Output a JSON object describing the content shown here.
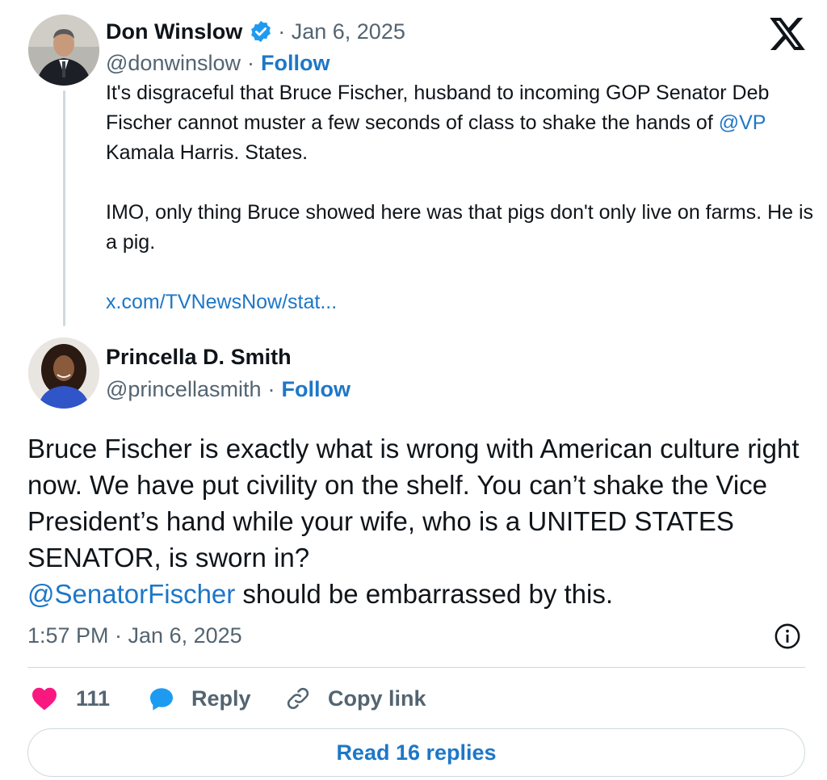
{
  "parent_tweet": {
    "author_name": "Don Winslow",
    "separator_date": "· Jan 6, 2025",
    "handle": "@donwinslow",
    "dot": "·",
    "follow_label": "Follow",
    "para1_prefix": "It's disgraceful that Bruce Fischer, husband to incoming GOP Senator Deb Fischer cannot muster a few seconds of class to shake the hands of ",
    "para1_mention": "@VP",
    "para1_suffix": " Kamala Harris. States.",
    "para2": "IMO, only thing Bruce showed here was that pigs don't only live on farms. He is a pig.",
    "link": "x.com/TVNewsNow/stat..."
  },
  "main_tweet": {
    "author_name": "Princella D. Smith",
    "handle": "@princellasmith",
    "dot": "·",
    "follow_label": "Follow",
    "text_main": "Bruce Fischer is exactly what is wrong with American culture right now. We have put civility on the shelf. You can’t shake the Vice President’s hand while your wife, who is a UNITED STATES SENATOR, is sworn in?",
    "mention": "@SenatorFischer",
    "text_suffix": " should be embarrassed by this.",
    "timestamp": "1:57 PM · Jan 6, 2025"
  },
  "actions": {
    "like_count": "111",
    "reply_label": "Reply",
    "copy_label": "Copy link"
  },
  "read_replies_label": "Read 16 replies",
  "icons": {
    "brand": "x-logo-icon",
    "verified": "verified-badge-icon",
    "like": "heart-icon",
    "reply": "reply-bubble-icon",
    "copy": "link-icon",
    "info": "info-icon"
  },
  "colors": {
    "link": "#1d77c8",
    "muted": "#536471",
    "heart": "#f91880",
    "verified": "#1d9bf0",
    "divider": "#cfd9de"
  }
}
